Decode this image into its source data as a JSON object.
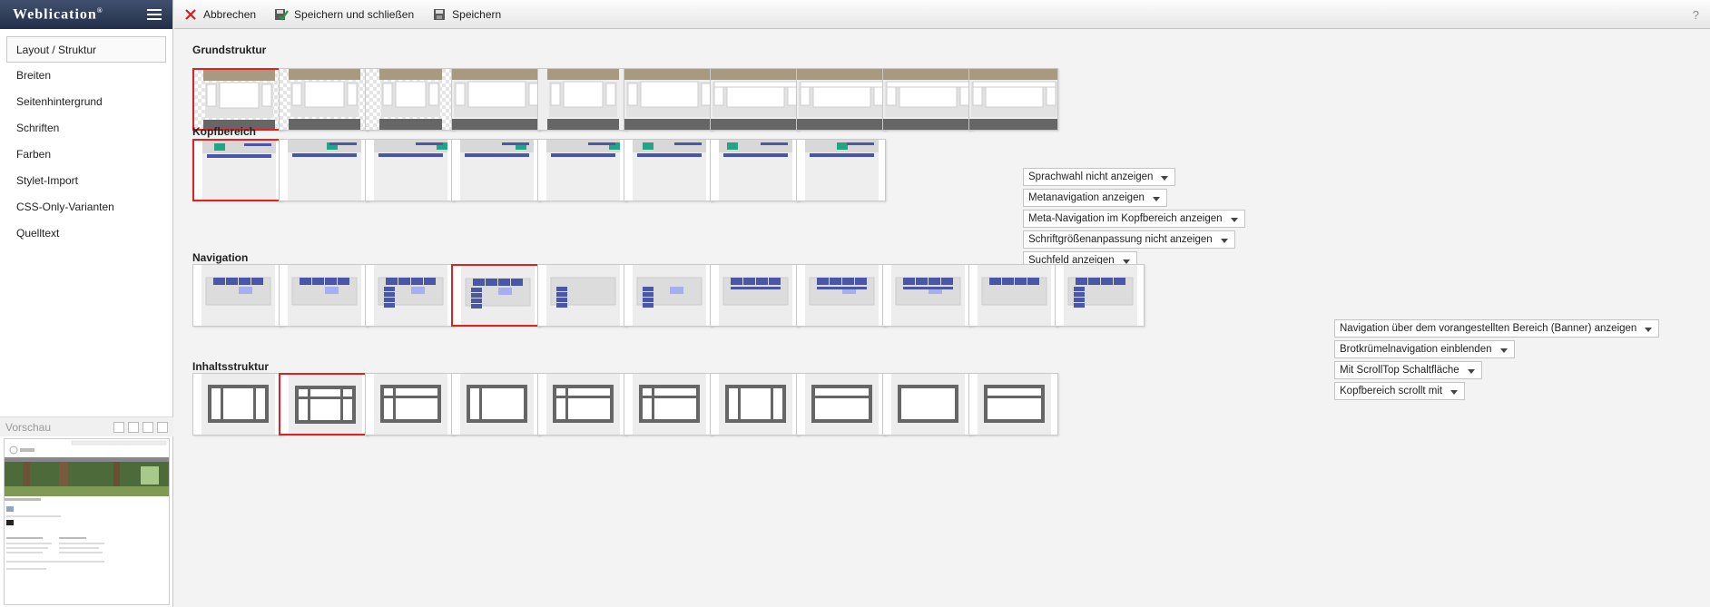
{
  "app": {
    "brand": "Weblication",
    "brand_mark": "®"
  },
  "sidebar": {
    "items": [
      {
        "label": "Layout / Struktur",
        "active": true
      },
      {
        "label": "Breiten"
      },
      {
        "label": "Seitenhintergrund"
      },
      {
        "label": "Schriften"
      },
      {
        "label": "Farben"
      },
      {
        "label": "Stylet-Import"
      },
      {
        "label": "CSS-Only-Varianten"
      },
      {
        "label": "Quelltext"
      }
    ],
    "preview_label": "Vorschau"
  },
  "toolbar": {
    "cancel_label": "Abbrechen",
    "save_close_label": "Speichern und schließen",
    "save_label": "Speichern",
    "help_label": "?"
  },
  "sections": {
    "grund": {
      "title": "Grundstruktur",
      "count": 10,
      "selected": 0
    },
    "kopf": {
      "title": "Kopfbereich",
      "count": 8,
      "selected": 0,
      "options": [
        "Sprachwahl nicht anzeigen",
        "Metanavigation anzeigen",
        "Meta-Navigation im Kopfbereich anzeigen",
        "Schriftgrößenanpassung nicht anzeigen",
        "Suchfeld anzeigen"
      ]
    },
    "nav": {
      "title": "Navigation",
      "count": 11,
      "selected": 3,
      "options": [
        "Navigation über dem vorangestellten Bereich (Banner) anzeigen",
        "Brotkrümelnavigation einblenden",
        "Mit ScrollTop Schaltfläche",
        "Kopfbereich scrollt mit"
      ]
    },
    "inhalt": {
      "title": "Inhaltsstruktur",
      "count": 10,
      "selected": 1
    }
  },
  "colors": {
    "accent_selected": "#dd2222",
    "header_tan": "#a79a80",
    "footer_dark": "#666666",
    "nav_blue": "#4a56a8",
    "nav_light": "#a6b0ee",
    "logo_green": "#24a386"
  },
  "icons": {
    "cancel": "close-icon",
    "save_close": "save-check-icon",
    "save": "floppy-disk-icon",
    "menu": "hamburger-icon"
  }
}
